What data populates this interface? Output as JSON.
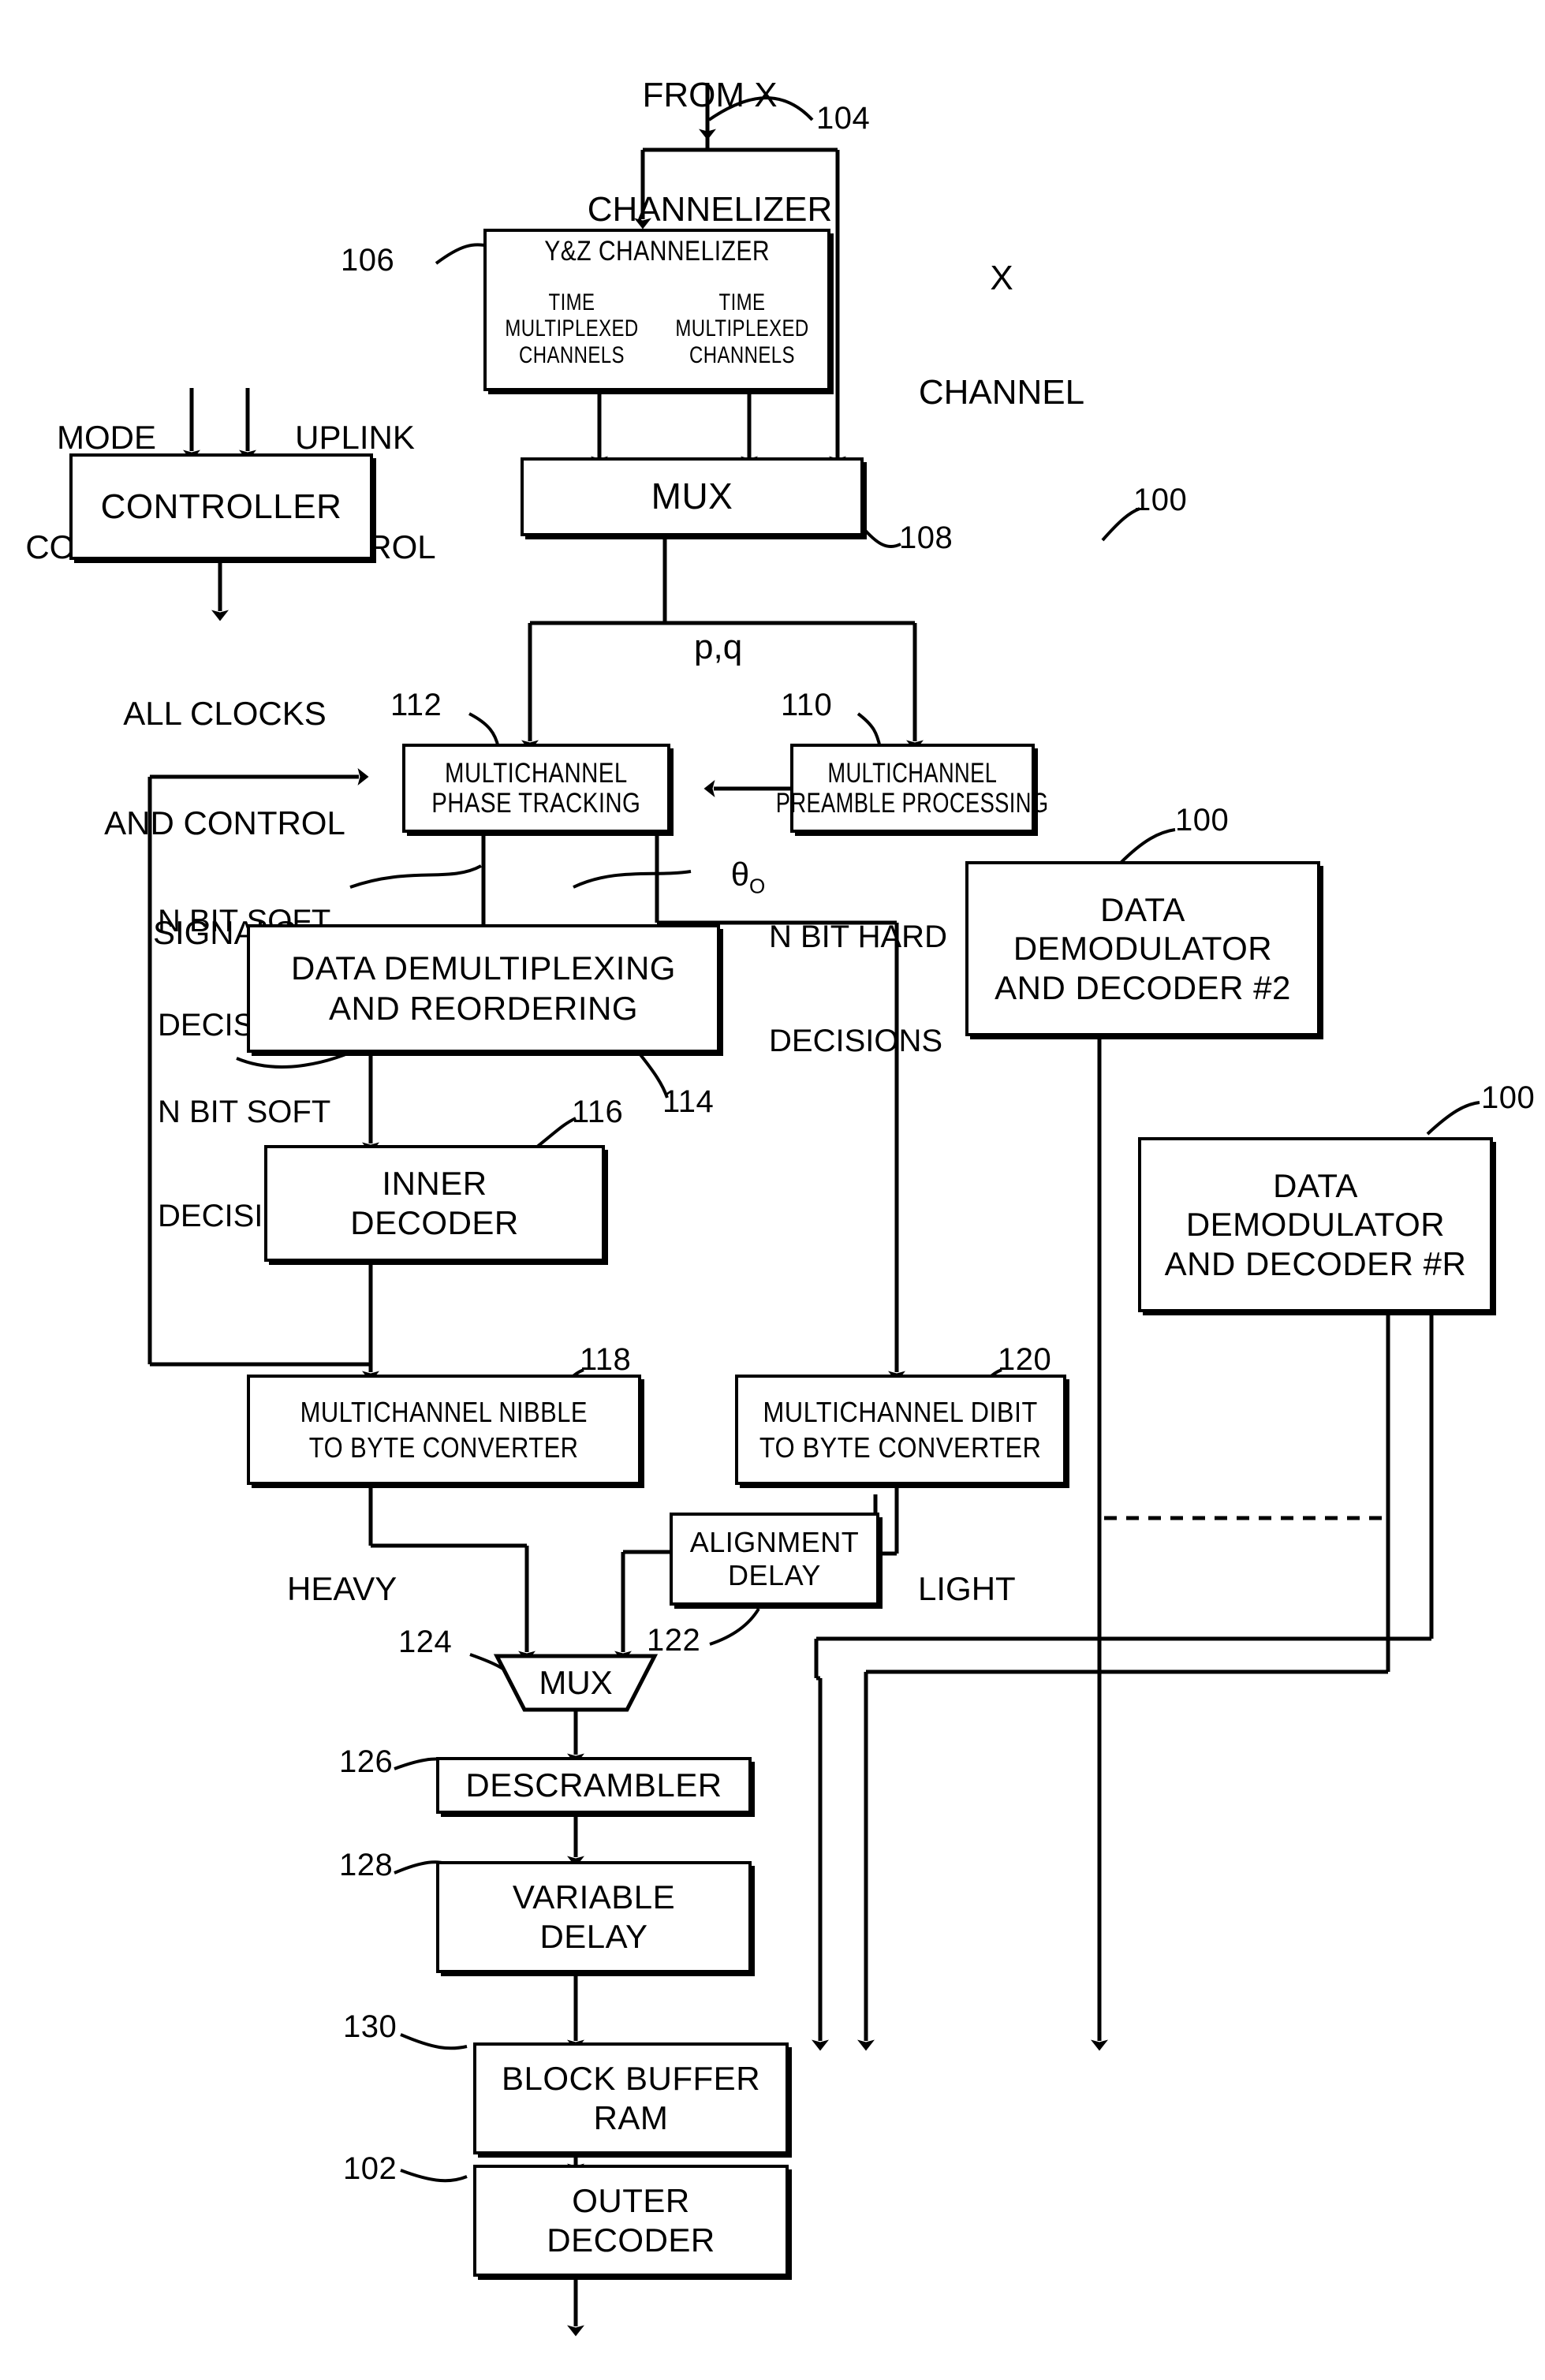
{
  "figure": {
    "title_ref": "100",
    "labels": {
      "from_x_channelizer": "FROM X\nCHANNELIZER",
      "x_channel": "X\nCHANNEL",
      "mode_control": "MODE\nCONTROL",
      "uplink_control": "UPLINK\nCONTROL",
      "all_clocks": "ALL CLOCKS\nAND CONTROL\nSIGNALS",
      "pq": "p,q",
      "theta_o": "θ",
      "theta_o_sub": "O",
      "n_bit_soft_1": "N BIT SOFT\nDECISIONS",
      "n_bit_soft_2": "N BIT SOFT\nDECISIONS",
      "n_bit_hard": "N BIT HARD\nDECISIONS",
      "heavy": "HEAVY",
      "light": "LIGHT"
    }
  },
  "blocks": [
    {
      "id": "yz-channelizer",
      "title": "Y&Z CHANNELIZER",
      "left_cell": "TIME\nMULTIPLEXED\nCHANNELS",
      "right_cell": "TIME\nMULTIPLEXED\nCHANNELS",
      "ref": "106"
    },
    {
      "id": "controller",
      "label": "CONTROLLER",
      "ref": ""
    },
    {
      "id": "mux-top",
      "label": "MUX",
      "ref": "108"
    },
    {
      "id": "multichannel-phase-tracking",
      "label": "MULTICHANNEL\nPHASE TRACKING",
      "ref": "112"
    },
    {
      "id": "multichannel-preamble-processing",
      "label": "MULTICHANNEL\nPREAMBLE PROCESSING",
      "ref": "110"
    },
    {
      "id": "data-demod-decoder-2",
      "label": "DATA\nDEMODULATOR\nAND DECODER #2",
      "ref": "100"
    },
    {
      "id": "data-demod-decoder-r",
      "label": "DATA\nDEMODULATOR\nAND DECODER #R",
      "ref": "100"
    },
    {
      "id": "data-demultiplexing-reordering",
      "label": "DATA DEMULTIPLEXING\nAND REORDERING",
      "ref": "114"
    },
    {
      "id": "inner-decoder",
      "label": "INNER\nDECODER",
      "ref": "116"
    },
    {
      "id": "multichannel-nibble-to-byte",
      "label": "MULTICHANNEL NIBBLE\nTO BYTE CONVERTER",
      "ref": "118"
    },
    {
      "id": "multichannel-dibit-to-byte",
      "label": "MULTICHANNEL DIBIT\nTO BYTE CONVERTER",
      "ref": "120"
    },
    {
      "id": "alignment-delay",
      "label": "ALIGNMENT\nDELAY",
      "ref": "122"
    },
    {
      "id": "mux-bottom",
      "label": "MUX",
      "ref": "124"
    },
    {
      "id": "descrambler",
      "label": "DESCRAMBLER",
      "ref": "126"
    },
    {
      "id": "variable-delay",
      "label": "VARIABLE\nDELAY",
      "ref": "128"
    },
    {
      "id": "block-buffer-ram",
      "label": "BLOCK BUFFER\nRAM",
      "ref": "130"
    },
    {
      "id": "outer-decoder",
      "label": "OUTER\nDECODER",
      "ref": "102"
    }
  ],
  "text": {
    "yz_title": "Y&Z CHANNELIZER",
    "tmc_time": "TIME",
    "tmc_mux": "MULTIPLEXED",
    "tmc_ch": "CHANNELS",
    "controller": "CONTROLLER",
    "mux_top": "MUX",
    "phase_l1": "MULTICHANNEL",
    "phase_l2": "PHASE TRACKING",
    "preamble_l1": "MULTICHANNEL",
    "preamble_l2": "PREAMBLE PROCESSING",
    "demod2_l1": "DATA",
    "demod2_l2": "DEMODULATOR",
    "demod2_l3": "AND DECODER #2",
    "demodr_l1": "DATA",
    "demodr_l2": "DEMODULATOR",
    "demodr_l3": "AND DECODER #R",
    "demux_l1": "DATA DEMULTIPLEXING",
    "demux_l2": "AND REORDERING",
    "inner_l1": "INNER",
    "inner_l2": "DECODER",
    "nibble_l1": "MULTICHANNEL NIBBLE",
    "nibble_l2": "TO BYTE CONVERTER",
    "dibit_l1": "MULTICHANNEL DIBIT",
    "dibit_l2": "TO BYTE CONVERTER",
    "align_l1": "ALIGNMENT",
    "align_l2": "DELAY",
    "mux_bottom": "MUX",
    "descrambler": "DESCRAMBLER",
    "vardelay_l1": "VARIABLE",
    "vardelay_l2": "DELAY",
    "bbram_l1": "BLOCK BUFFER",
    "bbram_l2": "RAM",
    "outer_l1": "OUTER",
    "outer_l2": "DECODER",
    "from_x_l1": "FROM X",
    "from_x_l2": "CHANNELIZER",
    "x_channel_l1": "X",
    "x_channel_l2": "CHANNEL",
    "mode_l1": "MODE",
    "mode_l2": "CONTROL",
    "uplink_l1": "UPLINK",
    "uplink_l2": "CONTROL",
    "clocks_l1": "ALL CLOCKS",
    "clocks_l2": "AND CONTROL",
    "clocks_l3": "SIGNALS",
    "pq": "p,q",
    "soft_l1": "N BIT SOFT",
    "soft_l2": "DECISIONS",
    "soft2_l1": "N BIT SOFT",
    "soft2_l2": "DECISIONS",
    "hard_l1": "N BIT HARD",
    "hard_l2": "DECISIONS",
    "heavy": "HEAVY",
    "light": "LIGHT",
    "theta": "θ"
  },
  "refs": {
    "r100a": "100",
    "r100b": "100",
    "r100c": "100",
    "r102": "102",
    "r104": "104",
    "r106": "106",
    "r108": "108",
    "r110": "110",
    "r112": "112",
    "r114": "114",
    "r116": "116",
    "r118": "118",
    "r120": "120",
    "r122": "122",
    "r124": "124",
    "r126": "126",
    "r128": "128",
    "r130": "130"
  },
  "colors": {
    "ink": "#000000",
    "paper": "#ffffff"
  }
}
